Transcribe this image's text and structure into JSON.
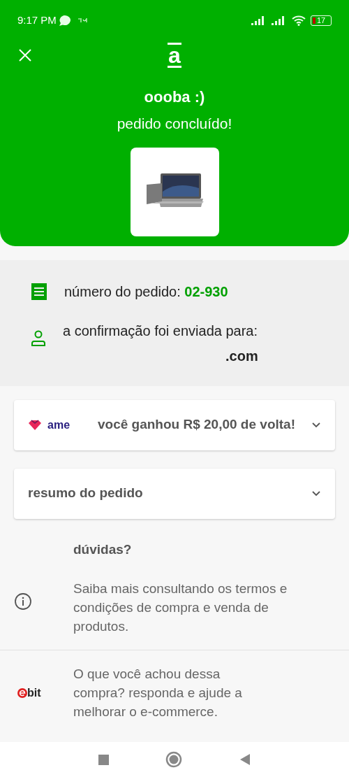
{
  "status_bar": {
    "time": "9:17 PM",
    "battery": "17"
  },
  "header": {
    "logo": "a",
    "title": "oooba :)",
    "subtitle": "pedido concluído!"
  },
  "order_info": {
    "number_label": "número do pedido:",
    "number": "02-930",
    "confirmation_label": "a confirmação foi enviada para:",
    "email": ".com"
  },
  "cashback": {
    "brand": "ame",
    "text": "você ganhou **R$ 20,00 de volta!**",
    "expanded": false
  },
  "summary": {
    "title": "resumo do pedido",
    "expanded": false
  },
  "help": {
    "title": "dúvidas?",
    "text": "Saiba mais consultando os termos e condições de compra e venda de produtos."
  },
  "feedback": {
    "brand": "bit",
    "text": "O que você achou dessa compra? responda e ajude a melhorar o e-commerce."
  }
}
